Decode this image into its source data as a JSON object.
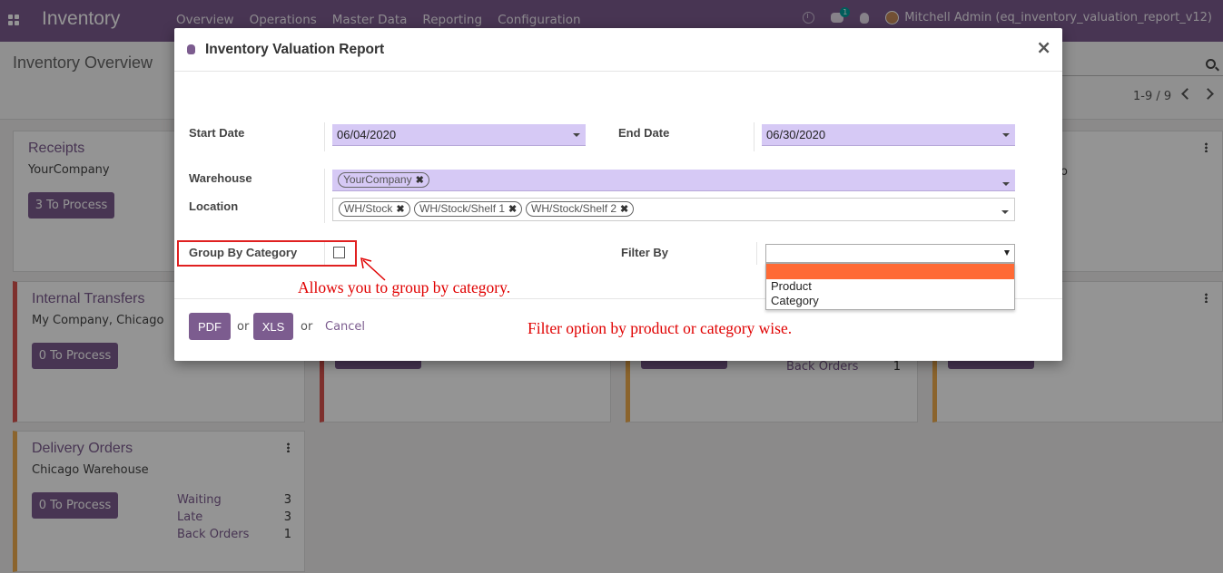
{
  "navbar": {
    "app_name": "Inventory",
    "menu": [
      "Overview",
      "Operations",
      "Master Data",
      "Reporting",
      "Configuration"
    ],
    "chat_badge": "1",
    "user": "Mitchell Admin (eq_inventory_valuation_report_v12)",
    "color": "#7c5c8f"
  },
  "control_panel": {
    "title": "Inventory Overview",
    "pager": "1-9 / 9"
  },
  "board": {
    "cards": [
      {
        "title": "Receipts",
        "subtitle": "YourCompany",
        "button": "3 To Process"
      },
      {
        "title": "Internal Transfers",
        "subtitle": "My Company, Chicago",
        "button": "0 To Process"
      },
      {
        "title": "Delivery Orders",
        "subtitle": "Chicago Warehouse",
        "button": "0 To Process",
        "stats": [
          {
            "label": "Waiting",
            "value": "3"
          },
          {
            "label": "Late",
            "value": "3"
          },
          {
            "label": "Back Orders",
            "value": "1"
          }
        ]
      }
    ],
    "partial_stat": {
      "label": "Back Orders",
      "value": "1"
    },
    "partial_text": "o"
  },
  "modal": {
    "title": "Inventory Valuation Report",
    "start_date_label": "Start Date",
    "start_date": "06/04/2020",
    "end_date_label": "End Date",
    "end_date": "06/30/2020",
    "warehouse_label": "Warehouse",
    "warehouse_tags": [
      "YourCompany"
    ],
    "location_label": "Location",
    "location_tags": [
      "WH/Stock",
      "WH/Stock/Shelf 1",
      "WH/Stock/Shelf 2"
    ],
    "group_by_label": "Group By Category",
    "group_by_checked": false,
    "filter_by_label": "Filter By",
    "filter_value": "",
    "filter_options": [
      "",
      "Product",
      "Category"
    ],
    "pdf_label": "PDF",
    "xls_label": "XLS",
    "or_label": "or",
    "cancel_label": "Cancel"
  },
  "annotations": {
    "group_note": "Allows you to group by category.",
    "filter_note": "Filter option by product or category wise.",
    "color": "#e00000"
  }
}
